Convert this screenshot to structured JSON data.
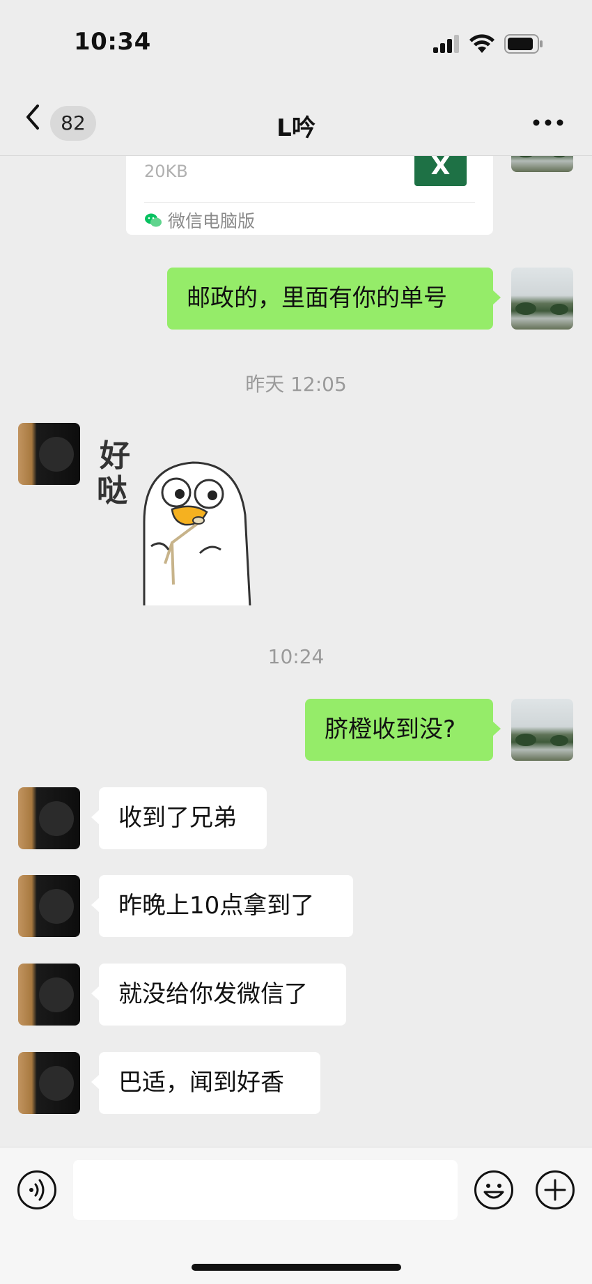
{
  "status_bar": {
    "time": "10:34",
    "icons": [
      "signal-icon",
      "wifi-icon",
      "battery-icon"
    ]
  },
  "nav": {
    "unread_count": "82",
    "title": "L吟",
    "icons": [
      "chevron-left-icon",
      "more-icon"
    ]
  },
  "messages": {
    "file_card": {
      "size": "20KB",
      "file_icon_letter": "X",
      "source": "微信电脑版"
    },
    "msg_self_1": "邮政的，里面有你的单号",
    "time_1": "昨天 12:05",
    "sticker_text": "好哒",
    "time_2": "10:24",
    "msg_self_2": "脐橙收到没?",
    "msg_in_1": "收到了兄弟",
    "msg_in_2": "昨晚上10点拿到了",
    "msg_in_3": "就没给你发微信了",
    "msg_in_4": "巴适，闻到好香"
  },
  "input_bar": {
    "placeholder": "",
    "icons": [
      "voice-icon",
      "emoji-icon",
      "add-icon"
    ]
  },
  "colors": {
    "background": "#ededed",
    "outgoing_bubble": "#95ec69",
    "incoming_bubble": "#ffffff",
    "excel_green": "#1e7145",
    "wechat_green": "#07c160"
  }
}
